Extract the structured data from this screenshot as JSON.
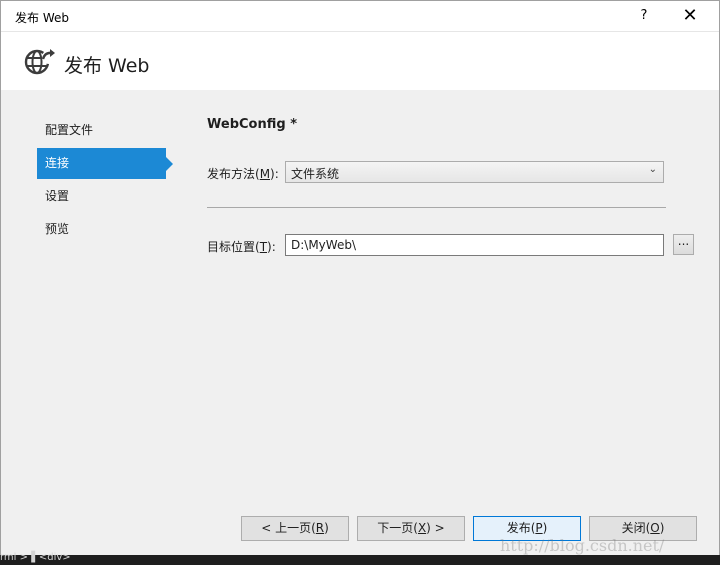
{
  "window": {
    "title": "发布 Web",
    "help_glyph": "?",
    "close_glyph": "✕"
  },
  "header": {
    "title": "发布 Web",
    "icon": "globe-publish-icon"
  },
  "nav": {
    "items": [
      {
        "label": "配置文件",
        "active": false
      },
      {
        "label": "连接",
        "active": true
      },
      {
        "label": "设置",
        "active": false
      },
      {
        "label": "预览",
        "active": false
      }
    ]
  },
  "main": {
    "section_title": "WebConfig *",
    "method": {
      "label_pre": "发布方法(",
      "label_key": "M",
      "label_post": "):",
      "value": "文件系统"
    },
    "target": {
      "label_pre": "目标位置(",
      "label_key": "T",
      "label_post": "):",
      "value": "D:\\MyWeb\\",
      "browse_label": "..."
    }
  },
  "buttons": {
    "prev": {
      "pre": "< 上一页(",
      "key": "R",
      "post": ")"
    },
    "next": {
      "pre": "下一页(",
      "key": "X",
      "post": ") >"
    },
    "publish": {
      "pre": "发布(",
      "key": "P",
      "post": ")"
    },
    "close": {
      "pre": "关闭(",
      "key": "O",
      "post": ")"
    }
  },
  "statusbar": {
    "text": "rml > ▌<div>"
  },
  "watermark": "http://blog.csdn.net/",
  "colors": {
    "accent": "#1c89d5",
    "dialog_bg": "#f0f0f0",
    "default_border": "#0078d7"
  }
}
